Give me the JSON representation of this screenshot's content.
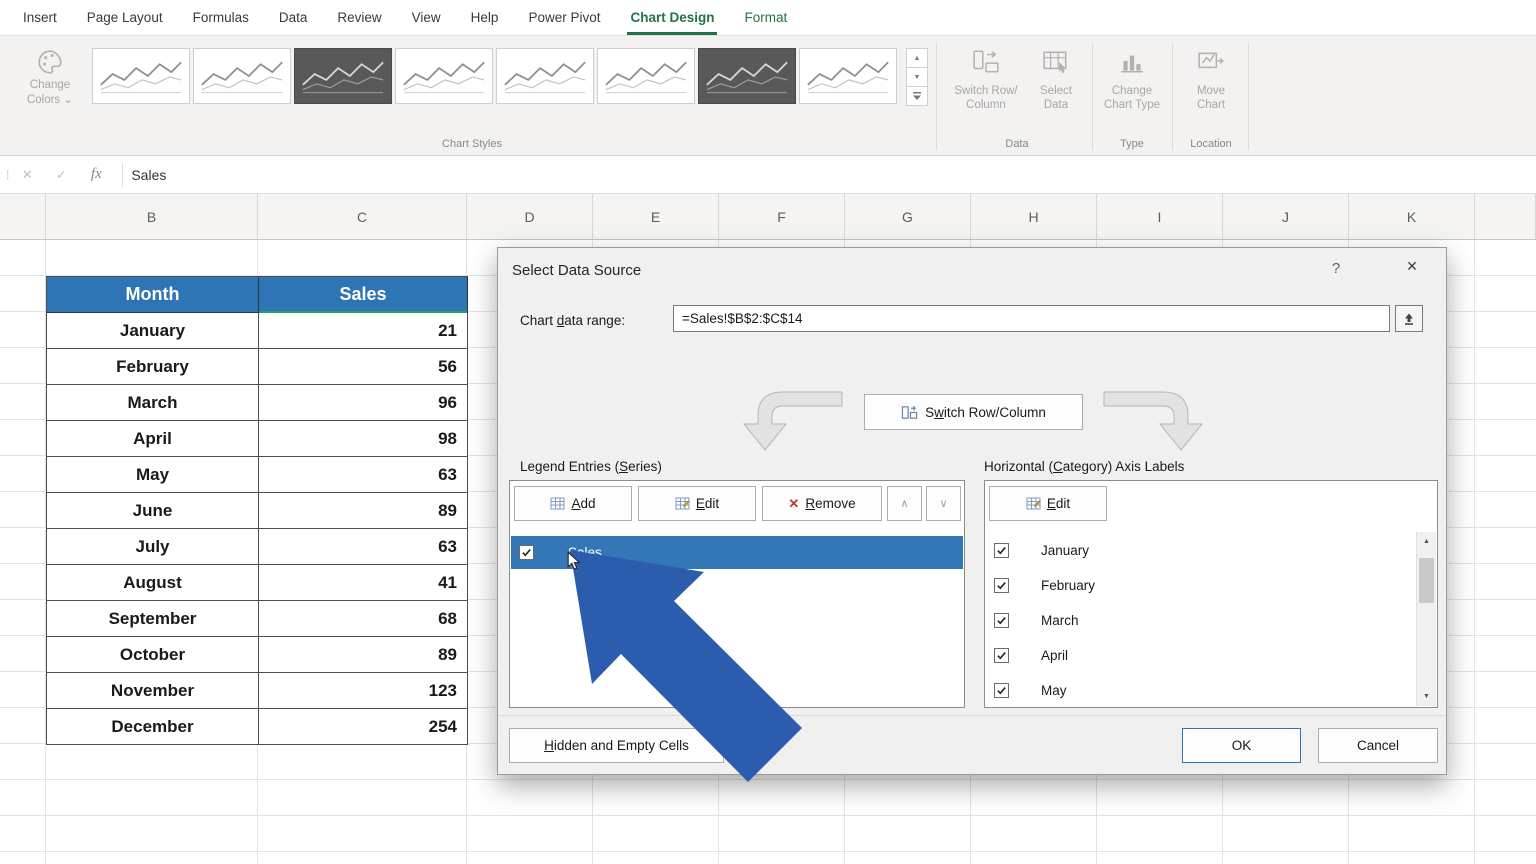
{
  "colors": {
    "accent_green": "#217346",
    "header_blue": "#2E75B6",
    "selection_blue": "#3377B6",
    "arrow_blue": "#2B5CAD",
    "range_green": "#21A366"
  },
  "ribbon": {
    "tabs": [
      {
        "label": "Insert"
      },
      {
        "label": "Page Layout"
      },
      {
        "label": "Formulas"
      },
      {
        "label": "Data"
      },
      {
        "label": "Review"
      },
      {
        "label": "View"
      },
      {
        "label": "Help"
      },
      {
        "label": "Power Pivot"
      },
      {
        "label": "Chart Design",
        "active": true,
        "contextual": true
      },
      {
        "label": "Format",
        "contextual": true
      }
    ],
    "change_colors": {
      "label_line1": "Change",
      "label_line2": "Colors"
    },
    "chart_styles": {
      "group_label": "Chart Styles",
      "styles": [
        {
          "name": "Style 1",
          "dark": false
        },
        {
          "name": "Style 2",
          "dark": false
        },
        {
          "name": "Style 3",
          "dark": true
        },
        {
          "name": "Style 4",
          "dark": false
        },
        {
          "name": "Style 5",
          "dark": false
        },
        {
          "name": "Style 6",
          "dark": false
        },
        {
          "name": "Style 7",
          "dark": true
        },
        {
          "name": "Style 8",
          "dark": false
        }
      ]
    },
    "data_group": {
      "group_label": "Data",
      "buttons": [
        {
          "line1": "Switch Row/",
          "line2": "Column"
        },
        {
          "line1": "Select",
          "line2": "Data"
        }
      ]
    },
    "type_group": {
      "group_label": "Type",
      "button": {
        "line1": "Change",
        "line2": "Chart Type"
      }
    },
    "location_group": {
      "group_label": "Location",
      "button": {
        "line1": "Move",
        "line2": "Chart"
      }
    }
  },
  "formula_bar": {
    "value": "Sales",
    "fx_label": "fx"
  },
  "grid": {
    "columns": [
      "",
      "B",
      "C",
      "D",
      "E",
      "F",
      "G",
      "H",
      "I",
      "J",
      "K",
      ""
    ]
  },
  "table": {
    "headers": [
      "Month",
      "Sales"
    ],
    "rows": [
      {
        "month": "January",
        "sales": "21"
      },
      {
        "month": "February",
        "sales": "56"
      },
      {
        "month": "March",
        "sales": "96"
      },
      {
        "month": "April",
        "sales": "98"
      },
      {
        "month": "May",
        "sales": "63"
      },
      {
        "month": "June",
        "sales": "89"
      },
      {
        "month": "July",
        "sales": "63"
      },
      {
        "month": "August",
        "sales": "41"
      },
      {
        "month": "September",
        "sales": "68"
      },
      {
        "month": "October",
        "sales": "89"
      },
      {
        "month": "November",
        "sales": "123"
      },
      {
        "month": "December",
        "sales": "254"
      }
    ]
  },
  "dialog": {
    "title": "Select Data Source",
    "help_glyph": "?",
    "close_glyph": "✕",
    "range": {
      "label": {
        "label": "Chart data range:",
        "key": "d"
      },
      "value": "=Sales!$B$2:$C$14"
    },
    "switch_button": {
      "label": "Switch Row/Column",
      "key": "w"
    },
    "legend": {
      "section_label": {
        "label": "Legend Entries (Series)",
        "key": "S"
      },
      "add": {
        "label": "Add",
        "key": "A"
      },
      "edit": {
        "label": "Edit",
        "key": "E"
      },
      "remove": {
        "label": "Remove",
        "key": "R"
      },
      "items": [
        {
          "label": "Sales",
          "checked": true,
          "selected": true
        }
      ]
    },
    "axis": {
      "section_label": {
        "label": "Horizontal (Category) Axis Labels",
        "key": "C"
      },
      "edit": {
        "label": "Edit",
        "key": "E"
      },
      "items": [
        {
          "label": "January",
          "checked": true
        },
        {
          "label": "February",
          "checked": true
        },
        {
          "label": "March",
          "checked": true
        },
        {
          "label": "April",
          "checked": true
        },
        {
          "label": "May",
          "checked": true
        }
      ]
    },
    "hidden_button": {
      "label": "Hidden and Empty Cells",
      "key": "H"
    },
    "ok": "OK",
    "cancel": "Cancel"
  }
}
